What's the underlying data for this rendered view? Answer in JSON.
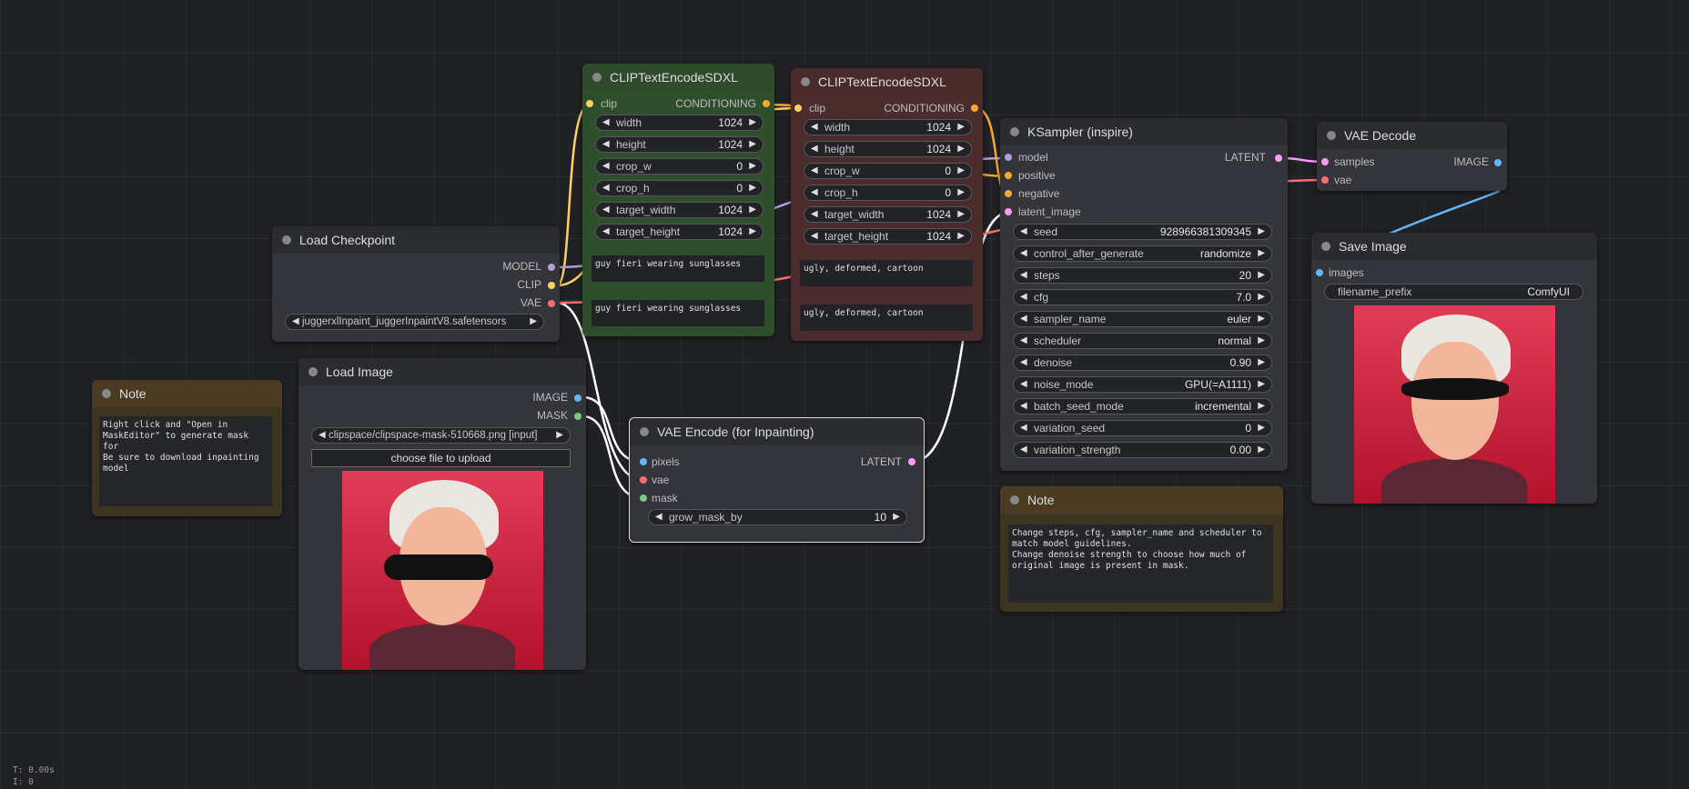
{
  "load_checkpoint": {
    "title": "Load Checkpoint",
    "outputs": [
      "MODEL",
      "CLIP",
      "VAE"
    ],
    "ckpt_name": "juggerxlInpaint_juggerInpaintV8.safetensors"
  },
  "clip_pos": {
    "title": "CLIPTextEncodeSDXL",
    "input": "clip",
    "output": "CONDITIONING",
    "widgets": [
      {
        "name": "width",
        "value": "1024"
      },
      {
        "name": "height",
        "value": "1024"
      },
      {
        "name": "crop_w",
        "value": "0"
      },
      {
        "name": "crop_h",
        "value": "0"
      },
      {
        "name": "target_width",
        "value": "1024"
      },
      {
        "name": "target_height",
        "value": "1024"
      }
    ],
    "text_g": "guy fieri wearing sunglasses",
    "text_l": "guy fieri wearing sunglasses"
  },
  "clip_neg": {
    "title": "CLIPTextEncodeSDXL",
    "input": "clip",
    "output": "CONDITIONING",
    "widgets": [
      {
        "name": "width",
        "value": "1024"
      },
      {
        "name": "height",
        "value": "1024"
      },
      {
        "name": "crop_w",
        "value": "0"
      },
      {
        "name": "crop_h",
        "value": "0"
      },
      {
        "name": "target_width",
        "value": "1024"
      },
      {
        "name": "target_height",
        "value": "1024"
      }
    ],
    "text_g": "ugly, deformed, cartoon",
    "text_l": "ugly, deformed, cartoon"
  },
  "ksampler": {
    "title": "KSampler (inspire)",
    "inputs": [
      "model",
      "positive",
      "negative",
      "latent_image"
    ],
    "output": "LATENT",
    "widgets": [
      {
        "name": "seed",
        "value": "928966381309345"
      },
      {
        "name": "control_after_generate",
        "value": "randomize"
      },
      {
        "name": "steps",
        "value": "20"
      },
      {
        "name": "cfg",
        "value": "7.0"
      },
      {
        "name": "sampler_name",
        "value": "euler"
      },
      {
        "name": "scheduler",
        "value": "normal"
      },
      {
        "name": "denoise",
        "value": "0.90"
      },
      {
        "name": "noise_mode",
        "value": "GPU(=A1111)"
      },
      {
        "name": "batch_seed_mode",
        "value": "incremental"
      },
      {
        "name": "variation_seed",
        "value": "0"
      },
      {
        "name": "variation_strength",
        "value": "0.00"
      }
    ]
  },
  "vae_decode": {
    "title": "VAE Decode",
    "inputs": [
      "samples",
      "vae"
    ],
    "output": "IMAGE"
  },
  "save_image": {
    "title": "Save Image",
    "input": "images",
    "widget_name": "filename_prefix",
    "widget_value": "ComfyUI"
  },
  "note1": {
    "title": "Note",
    "text": "Right click and \"Open in\nMaskEditor\" to generate mask for\nBe sure to download inpainting\nmodel"
  },
  "load_image": {
    "title": "Load Image",
    "outputs": [
      "IMAGE",
      "MASK"
    ],
    "image": "clipspace/clipspace-mask-510668.png [input]",
    "upload": "choose file to upload"
  },
  "vae_encode": {
    "title": "VAE Encode (for Inpainting)",
    "inputs": [
      "pixels",
      "vae",
      "mask"
    ],
    "output": "LATENT",
    "widget_name": "grow_mask_by",
    "widget_value": "10"
  },
  "note2": {
    "title": "Note",
    "text": "Change steps, cfg, sampler_name and scheduler to\nmatch model guidelines.\nChange denoise strength to choose how much of\noriginal image is present in mask."
  },
  "status": {
    "time": "T: 0.00s",
    "index": "I: 0"
  },
  "colors": {
    "model": "#b39ddb",
    "clip": "#ffd166",
    "vae": "#ff6e6e",
    "image": "#64b5f6",
    "mask": "#81c784",
    "latent": "#ff9cf9",
    "conditioning": "#ffa931"
  }
}
